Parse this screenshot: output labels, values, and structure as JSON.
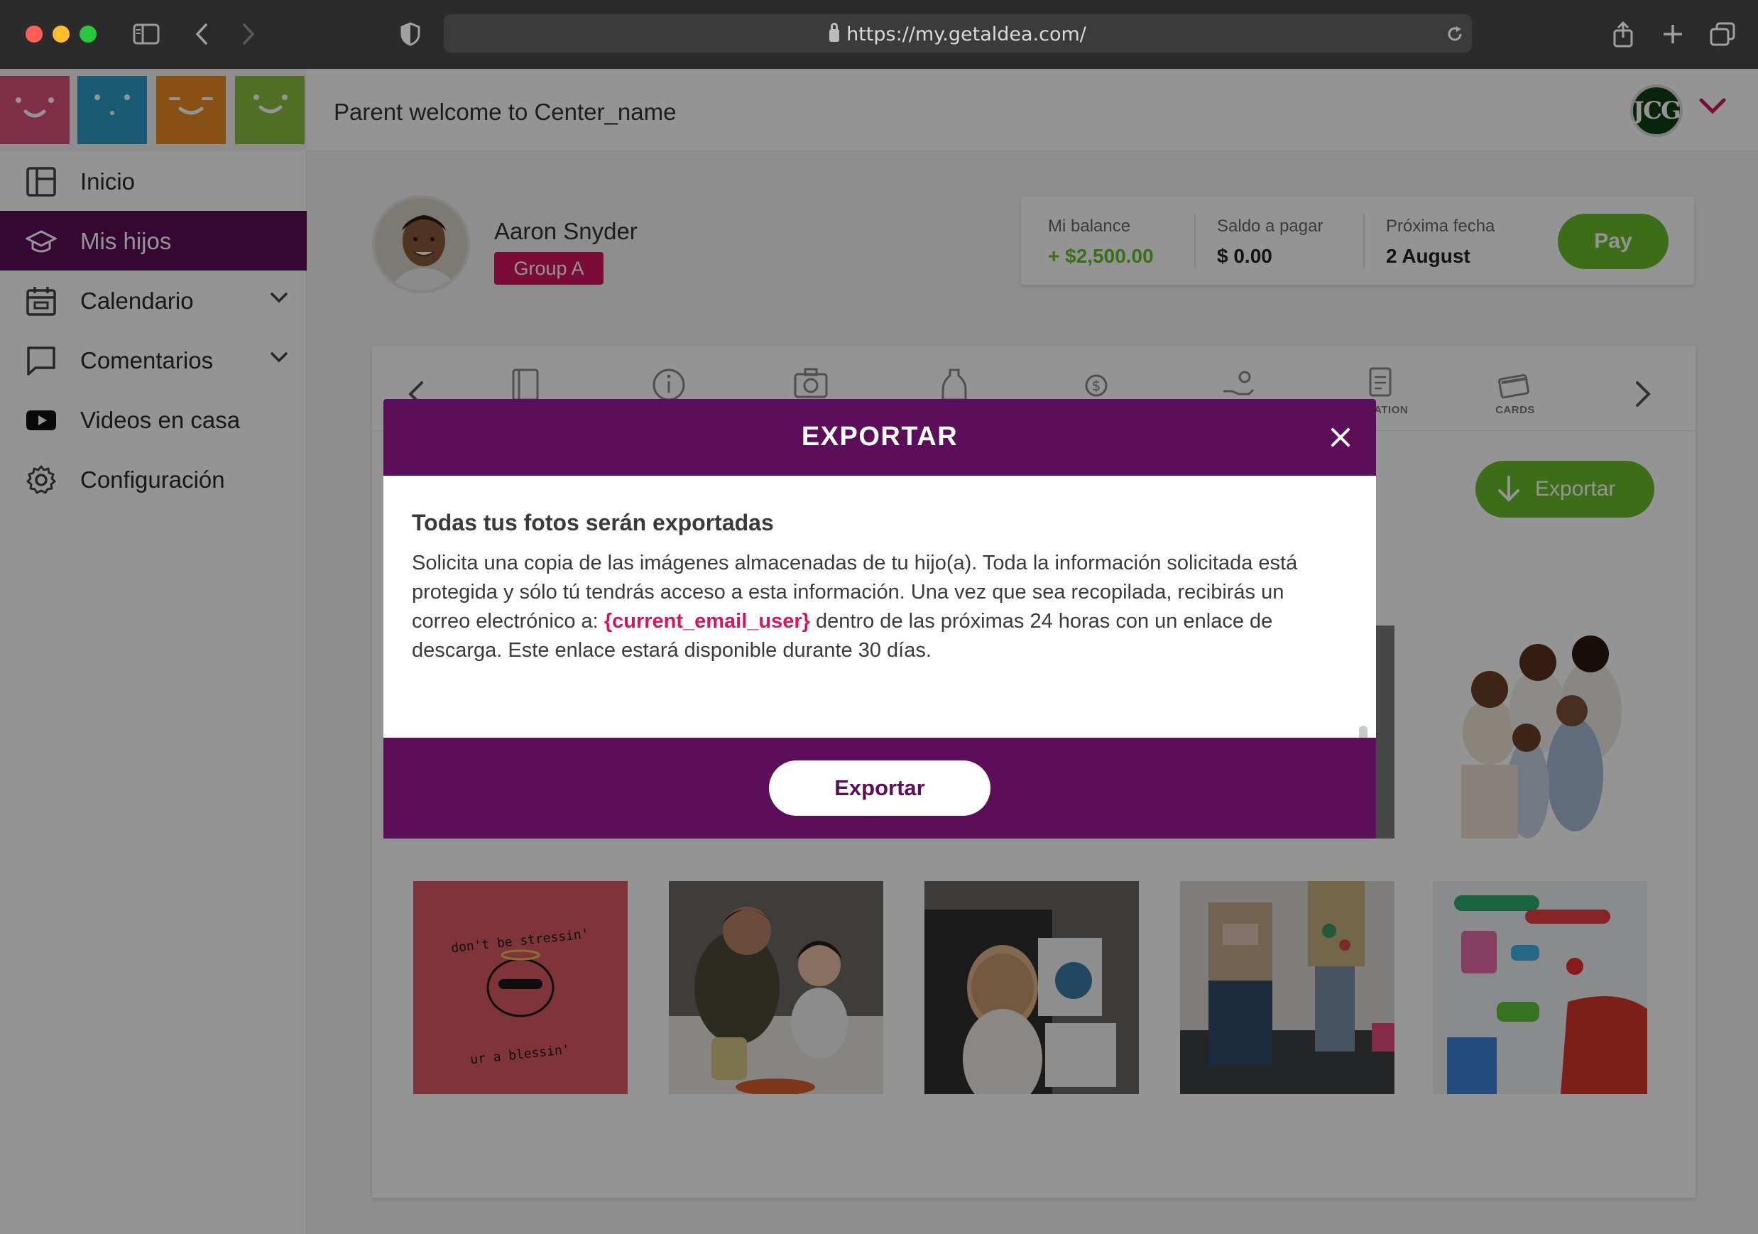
{
  "browser": {
    "url": "https://my.getaldea.com/"
  },
  "header": {
    "title": "Parent welcome to Center_name",
    "user_initials": "JCG"
  },
  "sidebar": {
    "items": [
      {
        "label": "Inicio",
        "icon": "dashboard-icon"
      },
      {
        "label": "Mis hijos",
        "icon": "graduation-cap-icon",
        "active": true
      },
      {
        "label": "Calendario",
        "icon": "calendar-icon",
        "expandable": true
      },
      {
        "label": "Comentarios",
        "icon": "chat-icon",
        "expandable": true
      },
      {
        "label": "Videos en casa",
        "icon": "youtube-icon"
      },
      {
        "label": "Configuración",
        "icon": "gear-icon"
      }
    ]
  },
  "child": {
    "name": "Aaron Snyder",
    "group": "Group A"
  },
  "balance": {
    "my_balance_label": "Mi balance",
    "my_balance_value": "+ $2,500.00",
    "due_label": "Saldo a pagar",
    "due_value": "$ 0.00",
    "next_date_label": "Próxima fecha",
    "next_date_value": "2 August",
    "pay_label": "Pay"
  },
  "tabs": {
    "visible_labels": [
      "ENTATION",
      "CARDS"
    ]
  },
  "panel": {
    "export_label": "Exportar"
  },
  "photos": {
    "sticker_top_text": "don't be stressin'",
    "sticker_bottom_text": "ur a blessin'"
  },
  "modal": {
    "title": "EXPORTAR",
    "heading": "Todas tus fotos serán exportadas",
    "text_before": "Solicita una copia de las imágenes almacenadas de tu hijo(a). Toda la información solicitada está protegida y sólo tú tendrás acceso a esta información. Una vez que sea recopilada, recibirás un correo electrónico a: ",
    "email_placeholder": "{current_email_user}",
    "text_after": " dentro de las próximas 24 horas con un enlace de descarga. Este enlace estará disponible durante 30 días.",
    "button_label": "Exportar"
  },
  "colors": {
    "brand_purple": "#5c0e5a",
    "accent_pink": "#d3165f",
    "accent_green": "#6cbc2c"
  }
}
